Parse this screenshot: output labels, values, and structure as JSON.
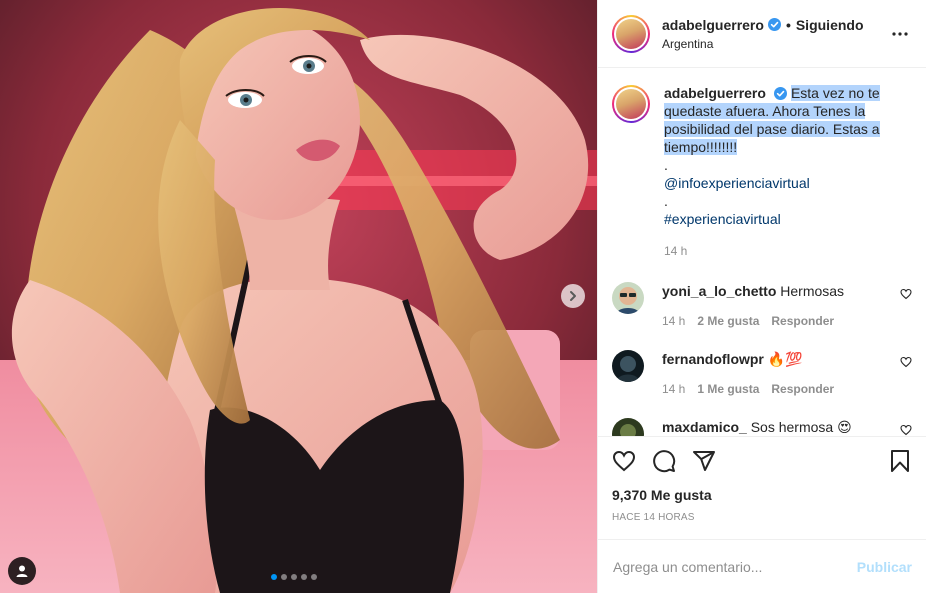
{
  "post": {
    "author": {
      "username": "adabelguerrero",
      "verified_icon": "verified-badge-icon",
      "follow_status": "Siguiendo",
      "location": "Argentina"
    },
    "caption": {
      "username": "adabelguerrero",
      "highlighted_text": "Esta vez no te quedaste afuera. Ahora Tenes la posibilidad del pase diario. Estas a tiempo!!!!!!!!",
      "dot1": ".",
      "mention": "@infoexperienciavirtual",
      "dot2": ".",
      "hashtag": "#experienciavirtual",
      "time": "14 h"
    },
    "comments": [
      {
        "username": "yoni_a_lo_chetto",
        "text": "Hermosas",
        "time": "14 h",
        "likes": "2 Me gusta",
        "reply": "Responder"
      },
      {
        "username": "fernandoflowpr",
        "text": "🔥💯",
        "time": "14 h",
        "likes": "1 Me gusta",
        "reply": "Responder"
      },
      {
        "username": "maxdamico_",
        "text": "Sos hermosa 😍",
        "time": "",
        "likes": "",
        "reply": ""
      }
    ],
    "likes_label": "9,370 Me gusta",
    "posted_ago": "HACE 14 HORAS",
    "comment_box": {
      "placeholder": "Agrega un comentario...",
      "publish_label": "Publicar"
    },
    "carousel": {
      "total": 5,
      "active_index": 0
    },
    "colors": {
      "link_blue": "#00376b",
      "accent_blue": "#0095f6",
      "publish_disabled": "#b2dffc",
      "selection": "#b3d4fc",
      "muted": "#8e8e8e"
    }
  }
}
